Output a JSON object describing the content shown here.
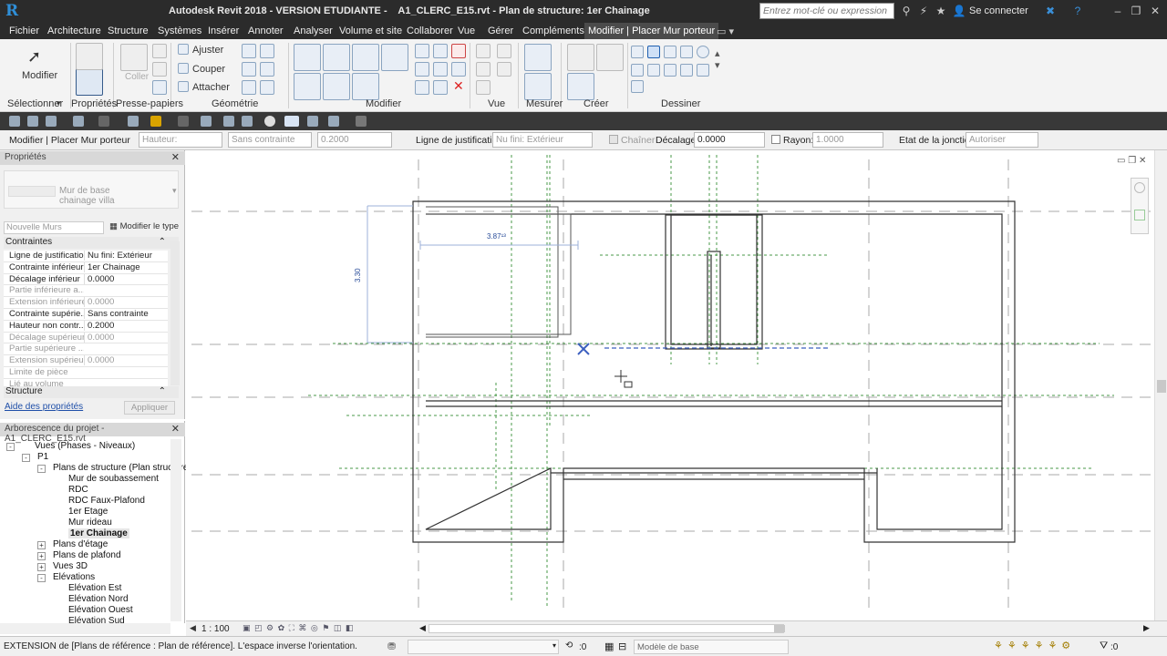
{
  "app": {
    "title": "Autodesk Revit 2018 - VERSION ETUDIANTE -    A1_CLERC_E15.rvt - Plan de structure: 1er Chainage",
    "search_placeholder": "Entrez mot-clé ou expression",
    "signin": "Se connecter",
    "logo": "R"
  },
  "menu": [
    "Fichier",
    "Architecture",
    "Structure",
    "Systèmes",
    "Insérer",
    "Annoter",
    "Analyser",
    "Volume et site",
    "Collaborer",
    "Vue",
    "Gérer",
    "Compléments",
    "Modifier | Placer Mur porteur"
  ],
  "ribbon": {
    "modify": "Modifier",
    "clipboard_paste": "Coller",
    "geom_items": [
      "Ajuster",
      "Couper",
      "Attacher"
    ],
    "groups": [
      "Sélectionner",
      "Propriétés",
      "Presse-papiers",
      "Géométrie",
      "Modifier",
      "Vue",
      "Mesurer",
      "Créer",
      "Dessiner"
    ]
  },
  "options": {
    "context": "Modifier | Placer Mur porteur",
    "height_label": "Hauteur:",
    "height_constraint": "Sans contrainte",
    "height_value": "0.2000",
    "justification_label": "Ligne de justification:",
    "justification_value": "Nu fini: Extérieur",
    "chain_label": "Chaîner",
    "offset_label": "Décalage:",
    "offset_value": "0.0000",
    "radius_label": "Rayon:",
    "radius_value": "1.0000",
    "join_label": "Etat de la jonction:",
    "join_value": "Autoriser"
  },
  "properties": {
    "title": "Propriétés",
    "type_name": "Mur de base",
    "type_sub": "chainage villa",
    "filter": "Nouvelle Murs",
    "edit_type": "Modifier le type",
    "section_constraints": "Contraintes",
    "section_structure": "Structure",
    "rows": [
      {
        "k": "Ligne de justification",
        "v": "Nu fini: Extérieur",
        "dis": false
      },
      {
        "k": "Contrainte inférieure",
        "v": "1er Chainage",
        "dis": false
      },
      {
        "k": "Décalage inférieur",
        "v": "0.0000",
        "dis": false
      },
      {
        "k": "Partie inférieure a...",
        "v": "",
        "dis": true
      },
      {
        "k": "Extension inférieure",
        "v": "0.0000",
        "dis": true
      },
      {
        "k": "Contrainte supérie...",
        "v": "Sans contrainte",
        "dis": false
      },
      {
        "k": "Hauteur non contr...",
        "v": "0.2000",
        "dis": false
      },
      {
        "k": "Décalage supérieur",
        "v": "0.0000",
        "dis": true
      },
      {
        "k": "Partie supérieure ...",
        "v": "",
        "dis": true
      },
      {
        "k": "Extension supérieure",
        "v": "0.0000",
        "dis": true
      },
      {
        "k": "Limite de pièce",
        "v": "",
        "dis": true
      },
      {
        "k": "Lié au volume",
        "v": "",
        "dis": true
      }
    ],
    "help": "Aide des propriétés",
    "apply": "Appliquer"
  },
  "browser": {
    "title": "Arborescence du projet - A1_CLERC_E15.rvt",
    "nodes": [
      {
        "label": "Vues (Phases - Niveaux)",
        "level": 0,
        "exp": "-",
        "sel": false
      },
      {
        "label": "P1",
        "level": 1,
        "exp": "-",
        "sel": false
      },
      {
        "label": "Plans de structure (Plan structure",
        "level": 2,
        "exp": "-",
        "sel": false
      },
      {
        "label": "Mur de soubassement",
        "level": 3,
        "exp": "",
        "sel": false
      },
      {
        "label": "RDC",
        "level": 3,
        "exp": "",
        "sel": false
      },
      {
        "label": "RDC Faux-Plafond",
        "level": 3,
        "exp": "",
        "sel": false
      },
      {
        "label": "1er Etage",
        "level": 3,
        "exp": "",
        "sel": false
      },
      {
        "label": "Mur rideau",
        "level": 3,
        "exp": "",
        "sel": false
      },
      {
        "label": "1er Chainage",
        "level": 3,
        "exp": "",
        "sel": true
      },
      {
        "label": "Plans d'étage",
        "level": 2,
        "exp": "+",
        "sel": false
      },
      {
        "label": "Plans de plafond",
        "level": 2,
        "exp": "+",
        "sel": false
      },
      {
        "label": "Vues 3D",
        "level": 2,
        "exp": "+",
        "sel": false
      },
      {
        "label": "Elévations",
        "level": 2,
        "exp": "-",
        "sel": false
      },
      {
        "label": "Elévation Est",
        "level": 3,
        "exp": "",
        "sel": false
      },
      {
        "label": "Elévation Nord",
        "level": 3,
        "exp": "",
        "sel": false
      },
      {
        "label": "Elévation Ouest",
        "level": 3,
        "exp": "",
        "sel": false
      },
      {
        "label": "Elévation Sud",
        "level": 3,
        "exp": "",
        "sel": false
      }
    ]
  },
  "drawing": {
    "dim_horizontal": "3.87¹³",
    "dim_vertical": "3.30"
  },
  "viewbar": {
    "scale": "1 : 100"
  },
  "status": {
    "message": "EXTENSION de [Plans de référence : Plan de référence].  L'espace inverse l'orientation.",
    "zero": ":0",
    "model": "Modèle de base",
    "filter_count": ":0"
  },
  "colors": {
    "accent": "#2f8fd8",
    "dark": "#2b2b2b",
    "active_tab": "#4b4b4b",
    "wall": "#333333",
    "ref_plane": "#3b5fbf",
    "guide_green": "#4a9a4a"
  }
}
